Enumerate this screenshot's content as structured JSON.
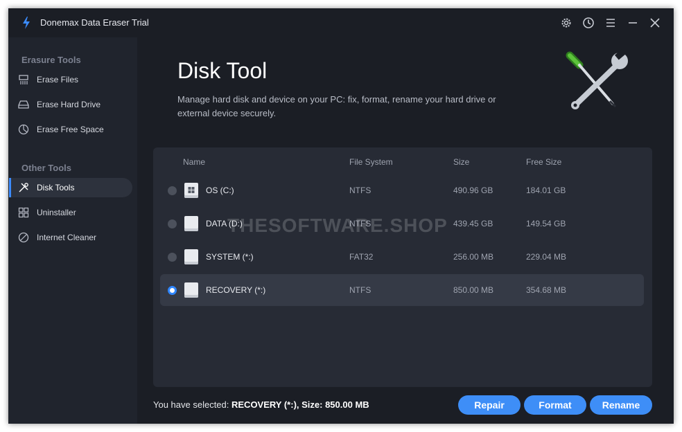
{
  "app": {
    "title": "Donemax Data Eraser Trial"
  },
  "titlebar_icons": [
    "gear-icon",
    "history-icon",
    "menu-icon",
    "minimize-icon",
    "close-icon"
  ],
  "sidebar": {
    "sections": [
      {
        "title": "Erasure Tools",
        "items": [
          {
            "label": "Erase Files",
            "icon": "shredder-icon"
          },
          {
            "label": "Erase Hard Drive",
            "icon": "hard-drive-icon"
          },
          {
            "label": "Erase Free Space",
            "icon": "pie-icon"
          }
        ]
      },
      {
        "title": "Other Tools",
        "items": [
          {
            "label": "Disk Tools",
            "icon": "tools-icon",
            "active": true
          },
          {
            "label": "Uninstaller",
            "icon": "grid-icon"
          },
          {
            "label": "Internet Cleaner",
            "icon": "globe-icon"
          }
        ]
      }
    ]
  },
  "main": {
    "title": "Disk Tool",
    "description": "Manage hard disk and device on your PC: fix, format, rename your hard drive or external device securely.",
    "table": {
      "headers": {
        "name": "Name",
        "fs": "File System",
        "size": "Size",
        "free": "Free Size"
      },
      "rows": [
        {
          "name": "OS (C:)",
          "fs": "NTFS",
          "size": "490.96 GB",
          "free": "184.01 GB",
          "selected": false,
          "windows": true
        },
        {
          "name": "DATA (D:)",
          "fs": "NTFS",
          "size": "439.45 GB",
          "free": "149.54 GB",
          "selected": false
        },
        {
          "name": "SYSTEM (*:)",
          "fs": "FAT32",
          "size": "256.00 MB",
          "free": "229.04 MB",
          "selected": false
        },
        {
          "name": "RECOVERY (*:)",
          "fs": "NTFS",
          "size": "850.00 MB",
          "free": "354.68 MB",
          "selected": true
        }
      ]
    },
    "watermark": "THESOFTWARE.SHOP",
    "status": {
      "prefix": "You have selected: ",
      "selection": "RECOVERY (*:), Size: 850.00 MB"
    },
    "buttons": {
      "repair": "Repair",
      "format": "Format",
      "rename": "Rename"
    }
  },
  "colors": {
    "accent": "#3e8ef7",
    "background": "#1b1e25",
    "sidebar": "#20242d",
    "panel": "#272b35"
  }
}
